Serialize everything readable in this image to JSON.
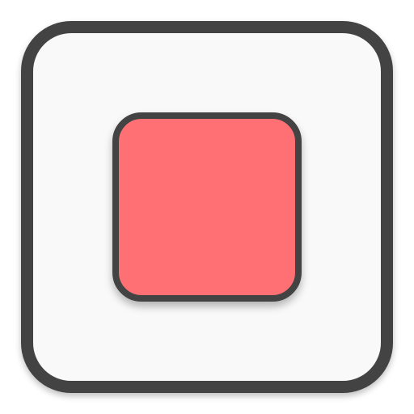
{
  "icon": {
    "name": "stop-icon",
    "colors": {
      "outline": "#434343",
      "tile_fill": "#f9f9f9",
      "stop_fill": "#ff7074"
    }
  }
}
